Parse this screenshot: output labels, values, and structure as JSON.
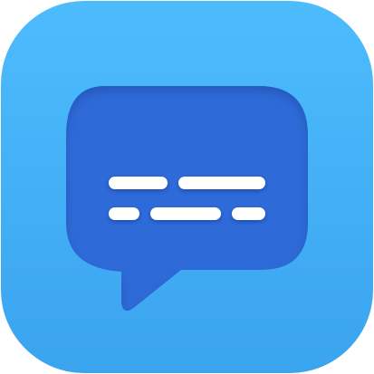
{
  "icon": {
    "name": "chat-bubble-icon",
    "colors": {
      "tile_top": "#4dbcfd",
      "tile_bottom": "#3aa4ef",
      "bubble": "#2f6bd8",
      "bubble_inner_shadow": "#1f4fb0",
      "lines": "#ffffff"
    }
  }
}
